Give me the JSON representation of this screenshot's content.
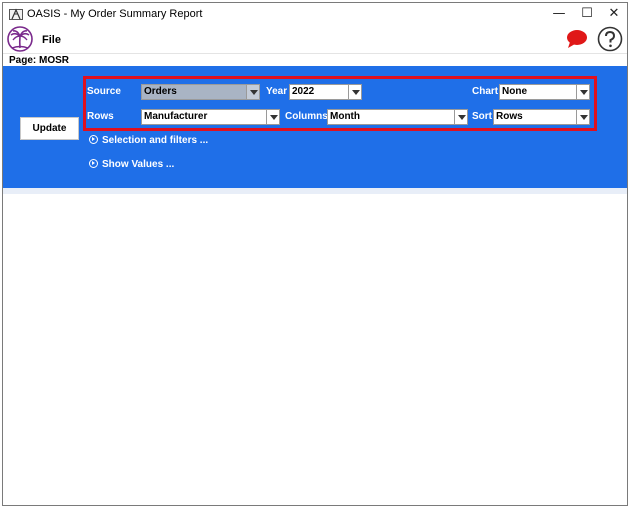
{
  "window": {
    "title": "OASIS - My Order Summary Report",
    "controls": {
      "minimize": "—",
      "maximize": "☐",
      "close": "✕"
    }
  },
  "menu": {
    "file": "File"
  },
  "page": {
    "label": "Page:  MOSR"
  },
  "panel": {
    "update_label": "Update",
    "source": {
      "label": "Source",
      "value": "Orders"
    },
    "year": {
      "label": "Year",
      "value": "2022"
    },
    "chart": {
      "label": "Chart",
      "value": "None"
    },
    "rows": {
      "label": "Rows",
      "value": "Manufacturer"
    },
    "columns": {
      "label": "Columns",
      "value": "Month"
    },
    "sort": {
      "label": "Sort",
      "value": "Rows"
    },
    "selection_filters": "Selection and filters ...",
    "show_values": "Show Values ..."
  },
  "icons": {
    "app": "oasis-app-icon",
    "logo": "oasis-palm-logo",
    "chat": "chat-bubble-icon",
    "help": "help-question-icon"
  },
  "colors": {
    "panel_bg": "#1f6fe8",
    "highlight": "#e0101e",
    "chat": "#e01818",
    "logo": "#7a2a8c"
  }
}
